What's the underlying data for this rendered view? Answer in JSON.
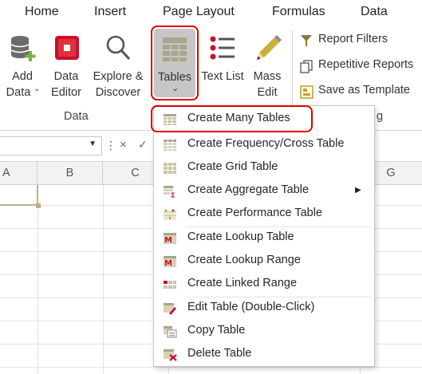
{
  "tabs": [
    "Home",
    "Insert",
    "Page Layout",
    "Formulas",
    "Data"
  ],
  "ribbon": {
    "add_data": {
      "line1": "Add",
      "line2": "Data"
    },
    "data_editor": {
      "line1": "Data",
      "line2": "Editor"
    },
    "explore": {
      "line1": "Explore &",
      "line2": "Discover"
    },
    "tables": {
      "label": "Tables"
    },
    "text_list": {
      "label": "Text List"
    },
    "mass_edit": {
      "line1": "Mass",
      "line2": "Edit"
    },
    "report_filters": "Report Filters",
    "repetitive_reports": "Repetitive Reports",
    "save_as_template": "Save as Template",
    "group_data": "Data",
    "group_right_partial": "g"
  },
  "formula_bar": {
    "cancel": "×",
    "enter": "✓"
  },
  "columns": [
    "A",
    "B",
    "C",
    "G"
  ],
  "menu": {
    "items": [
      {
        "label": "Create Many Tables"
      },
      {
        "label": "Create Frequency/Cross Table"
      },
      {
        "label": "Create Grid Table"
      },
      {
        "label": "Create Aggregate Table"
      },
      {
        "label": "Create Performance Table"
      },
      {
        "label": "Create Lookup Table"
      },
      {
        "label": "Create Lookup Range"
      },
      {
        "label": "Create Linked Range"
      },
      {
        "label": "Edit Table (Double-Click)"
      },
      {
        "label": "Copy Table"
      },
      {
        "label": "Delete Table"
      }
    ],
    "submenu_arrow": "▶"
  },
  "colors": {
    "highlight_red": "#e00000",
    "accent_red": "#d0021b",
    "ribbon_selected": "#c8c6c4"
  }
}
